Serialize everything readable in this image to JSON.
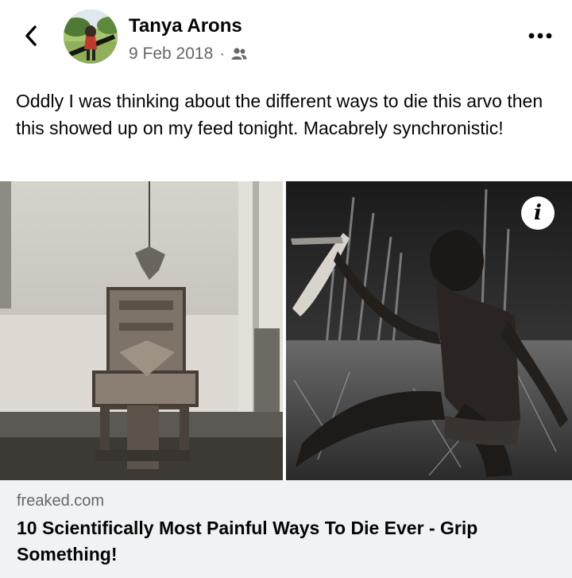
{
  "post": {
    "author": "Tanya Arons",
    "date": "9 Feb 2018",
    "separator": "·",
    "audience_icon": "friends-icon",
    "text": "Oddly I was thinking about the different ways to die this arvo then this showed up on my feed tonight.  Macabrely synchronistic!"
  },
  "link_preview": {
    "domain": "freaked.com",
    "title": "10 Scientifically Most Painful Ways To Die Ever - Grip Something!",
    "info_label": "i"
  },
  "icons": {
    "back": "back-chevron-icon",
    "more": "more-options-icon",
    "info": "info-icon"
  },
  "colors": {
    "text_primary": "#050505",
    "text_secondary": "#65676b",
    "link_background": "#f0f2f5"
  }
}
